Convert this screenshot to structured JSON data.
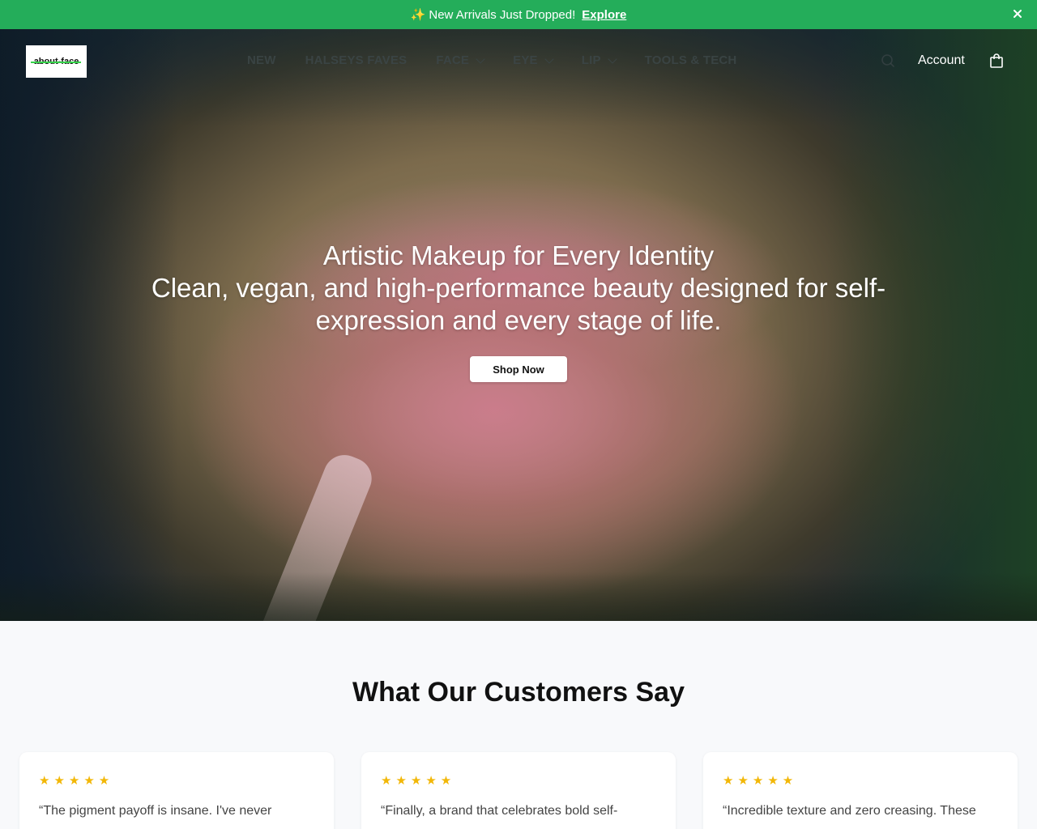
{
  "announcement": {
    "icon": "sparkles-icon",
    "text": "New Arrivals Just Dropped!",
    "link": "Explore",
    "close_label": "×"
  },
  "header": {
    "logo_text": "about-face",
    "menu": [
      {
        "label": "NEW",
        "dropdown": false
      },
      {
        "label": "HALSEYS FAVES",
        "dropdown": false
      },
      {
        "label": "FACE",
        "dropdown": true
      },
      {
        "label": "EYE",
        "dropdown": true
      },
      {
        "label": "LIP",
        "dropdown": true
      },
      {
        "label": "TOOLS & TECH",
        "dropdown": false
      }
    ],
    "account_label": "Account",
    "icons": {
      "search": "search-icon",
      "cart": "shopping-bag-icon"
    }
  },
  "hero": {
    "title": "Artistic Makeup for Every Identity",
    "subtitle": "Clean, vegan, and high-performance beauty designed for self-expression and every stage of life.",
    "cta": "Shop Now"
  },
  "testimonials": {
    "title": "What Our Customers Say",
    "cards": [
      {
        "rating": 5,
        "stars": "★★★★★",
        "quote": "“The pigment payoff is insane. I've never"
      },
      {
        "rating": 5,
        "stars": "★★★★★",
        "quote": "“Finally, a brand that celebrates bold self-"
      },
      {
        "rating": 5,
        "stars": "★★★★★",
        "quote": "“Incredible texture and zero creasing. These"
      }
    ]
  },
  "colors": {
    "announcement_bg": "#24ad5a",
    "star": "#f2b707",
    "logo_accent": "#35d24a"
  }
}
